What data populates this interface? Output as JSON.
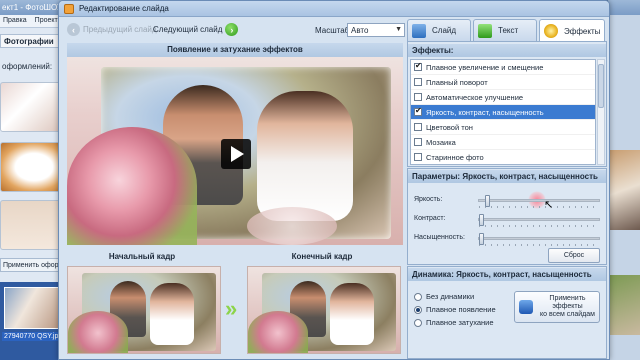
{
  "background_app": {
    "title": "ект1 - ФотоШОУ",
    "menu": [
      "Правка",
      "Проект"
    ],
    "tab": "Фотографии",
    "style_label": "оформлений:",
    "apply_label": "Применить офор",
    "file_name": "27940770 QSY.jpg"
  },
  "dialog": {
    "title": "Редактирование слайда"
  },
  "toolbar": {
    "prev_label": "Предыдущий слайд",
    "next_label": "Следующий слайд",
    "zoom_label": "Масштаб:",
    "zoom_value": "Авто"
  },
  "preview": {
    "header": "Появление и затухание эффектов"
  },
  "frames": {
    "start_label": "Начальный кадр",
    "end_label": "Конечный кадр"
  },
  "tabs": [
    {
      "label": "Слайд"
    },
    {
      "label": "Текст"
    },
    {
      "label": "Эффекты"
    }
  ],
  "effects": {
    "header": "Эффекты:",
    "items": [
      {
        "label": "Плавное увеличение и смещение",
        "checked": true,
        "selected": false
      },
      {
        "label": "Плавный поворот",
        "checked": false,
        "selected": false
      },
      {
        "label": "Автоматическое улучшение",
        "checked": false,
        "selected": false
      },
      {
        "label": "Яркость, контраст, насыщенность",
        "checked": true,
        "selected": true
      },
      {
        "label": "Цветовой тон",
        "checked": false,
        "selected": false
      },
      {
        "label": "Мозаика",
        "checked": false,
        "selected": false
      },
      {
        "label": "Старинное фото",
        "checked": false,
        "selected": false
      }
    ]
  },
  "parameters": {
    "header": "Параметры: Яркость, контраст, насыщенность",
    "brightness_label": "Яркость:",
    "contrast_label": "Контраст:",
    "saturation_label": "Насыщенность:",
    "reset_label": "Сброс",
    "brightness_value": 0.05,
    "contrast_value": 0.0,
    "saturation_value": 0.0
  },
  "dynamics": {
    "header": "Динамика: Яркость, контраст, насыщенность",
    "options": [
      {
        "label": "Без динамики",
        "selected": false
      },
      {
        "label": "Плавное появление",
        "selected": true
      },
      {
        "label": "Плавное затухание",
        "selected": false
      }
    ],
    "apply_all_label": "Применить эффекты\nко всем слайдам"
  }
}
